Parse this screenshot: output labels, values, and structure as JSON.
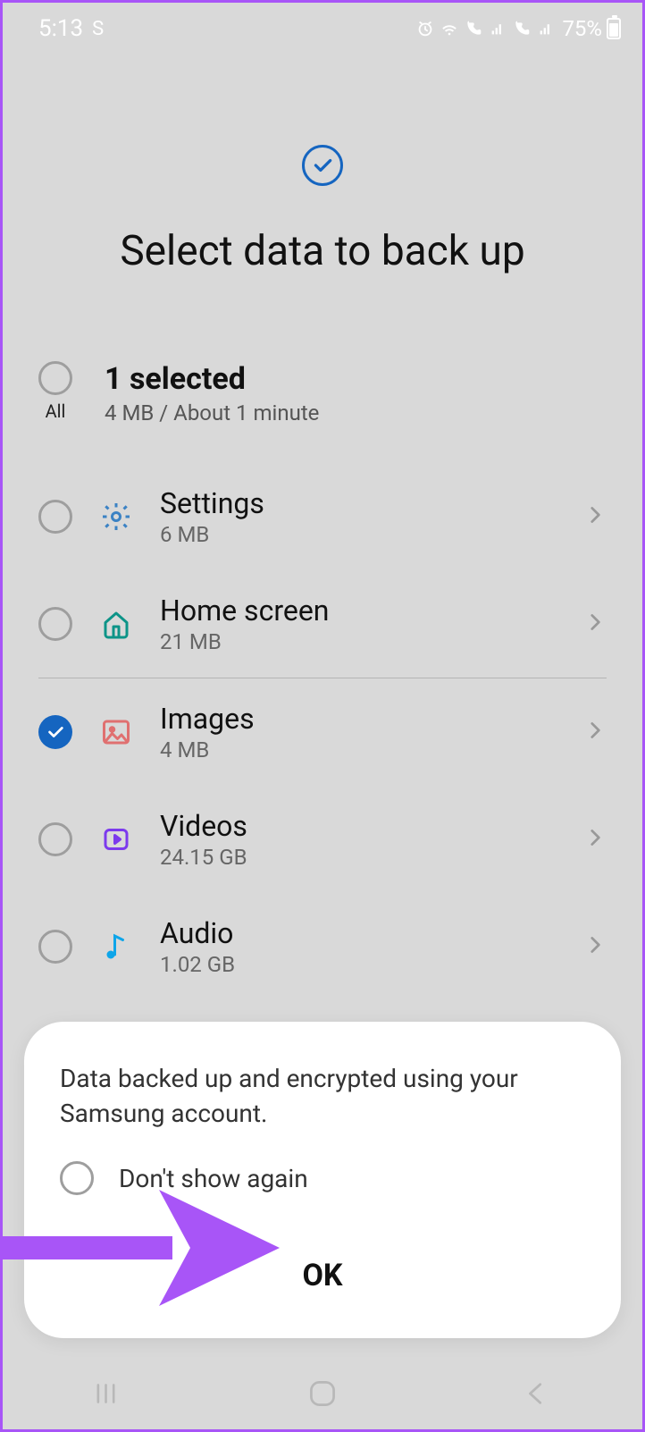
{
  "status": {
    "time": "5:13",
    "indicator": "S",
    "battery": "75%"
  },
  "header": {
    "title": "Select data to back up"
  },
  "summary": {
    "all_label": "All",
    "count": "1 selected",
    "sub": "4 MB / About 1 minute"
  },
  "items": [
    {
      "name": "Settings",
      "size": "6 MB",
      "checked": false,
      "icon": "gear",
      "color": "#3b82c4"
    },
    {
      "name": "Home screen",
      "size": "21 MB",
      "checked": false,
      "icon": "home",
      "color": "#0d9488"
    },
    {
      "name": "Images",
      "size": "4 MB",
      "checked": true,
      "icon": "image",
      "color": "#e07070"
    },
    {
      "name": "Videos",
      "size": "24.15 GB",
      "checked": false,
      "icon": "video",
      "color": "#7c3aed"
    },
    {
      "name": "Audio",
      "size": "1.02 GB",
      "checked": false,
      "icon": "audio",
      "color": "#0ea5e9"
    }
  ],
  "dialog": {
    "message": "Data backed up and encrypted using your Samsung account.",
    "checkbox_label": "Don't show again",
    "ok": "OK"
  }
}
